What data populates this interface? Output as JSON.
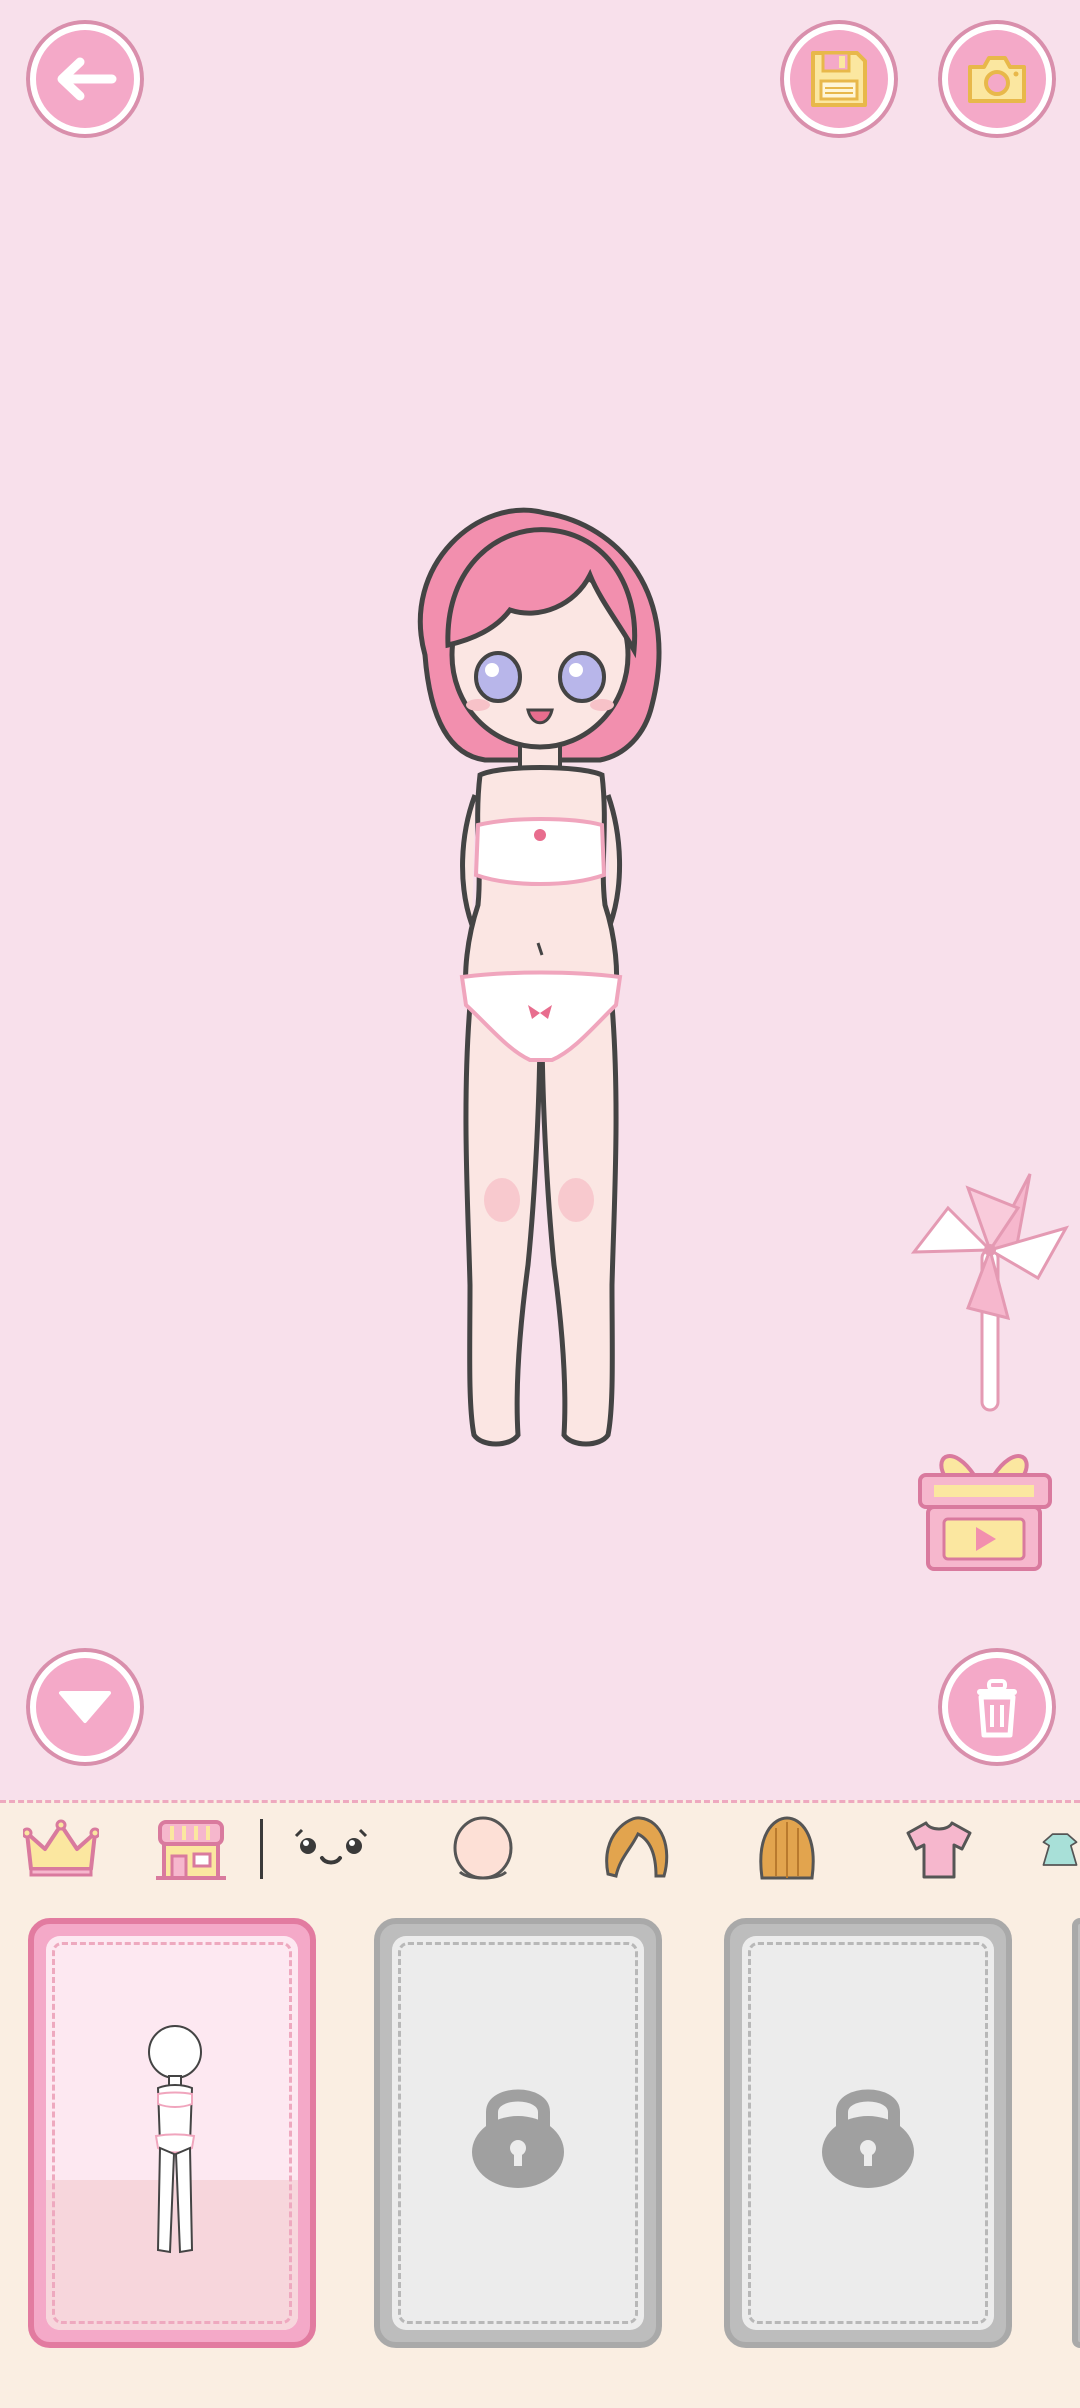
{
  "toolbar": {
    "back": "back-arrow-icon",
    "save": "floppy-disk-icon",
    "camera": "camera-icon",
    "collapse": "triangle-down-icon",
    "delete": "trash-icon"
  },
  "side_items": [
    "pinwheel-icon",
    "gift-video-icon"
  ],
  "categories": [
    {
      "name": "crown-icon"
    },
    {
      "name": "shop-icon"
    },
    {
      "name": "expression-icon"
    },
    {
      "name": "face-icon"
    },
    {
      "name": "hair-front-icon"
    },
    {
      "name": "hair-back-icon"
    },
    {
      "name": "top-icon"
    },
    {
      "name": "dress-icon"
    }
  ],
  "cards": [
    {
      "state": "selected",
      "content": "base-character"
    },
    {
      "state": "locked",
      "content": "lock-icon"
    },
    {
      "state": "locked",
      "content": "lock-icon"
    }
  ],
  "colors": {
    "background": "#f8e0eb",
    "accent_pink": "#f4a9c8",
    "icon_yellow": "#fbe7a0",
    "panel_cream": "#faeee2"
  }
}
